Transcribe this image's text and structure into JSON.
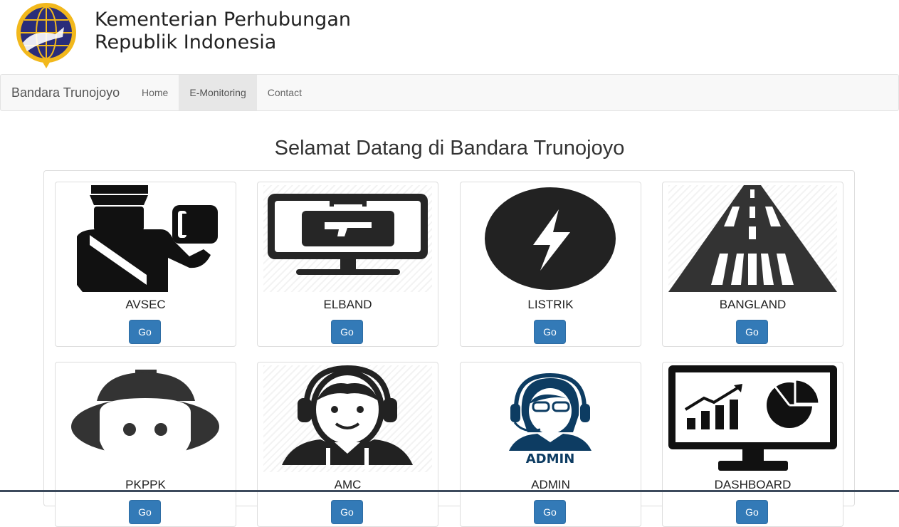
{
  "header": {
    "org_line1": "Kementerian Perhubungan",
    "org_line2": "Republik Indonesia",
    "logo_icon": "kemenhub-logo-icon"
  },
  "navbar": {
    "brand": "Bandara Trunojoyo",
    "items": [
      {
        "label": "Home",
        "active": false
      },
      {
        "label": "E-Monitoring",
        "active": true
      },
      {
        "label": "Contact",
        "active": false
      }
    ]
  },
  "main": {
    "title": "Selamat Datang di Bandara Trunojoyo",
    "cards": [
      {
        "label": "AVSEC",
        "button": "Go",
        "icon": "security-officer-icon"
      },
      {
        "label": "ELBAND",
        "button": "Go",
        "icon": "xray-monitor-icon"
      },
      {
        "label": "LISTRIK",
        "button": "Go",
        "icon": "lightning-icon"
      },
      {
        "label": "BANGLAND",
        "button": "Go",
        "icon": "runway-icon"
      },
      {
        "label": "PKPPK",
        "button": "Go",
        "icon": "firefighter-icon"
      },
      {
        "label": "AMC",
        "button": "Go",
        "icon": "headset-operator-icon"
      },
      {
        "label": "ADMIN",
        "button": "Go",
        "icon": "admin-operator-icon",
        "badge": "ADMIN"
      },
      {
        "label": "DASHBOARD",
        "button": "Go",
        "icon": "dashboard-monitor-icon"
      }
    ]
  },
  "colors": {
    "primary_button": "#337ab7",
    "navbar_bg": "#f8f8f8",
    "logo_blue": "#2a2d7a",
    "logo_gold": "#f2b81c",
    "admin_blue": "#0d3c62"
  }
}
